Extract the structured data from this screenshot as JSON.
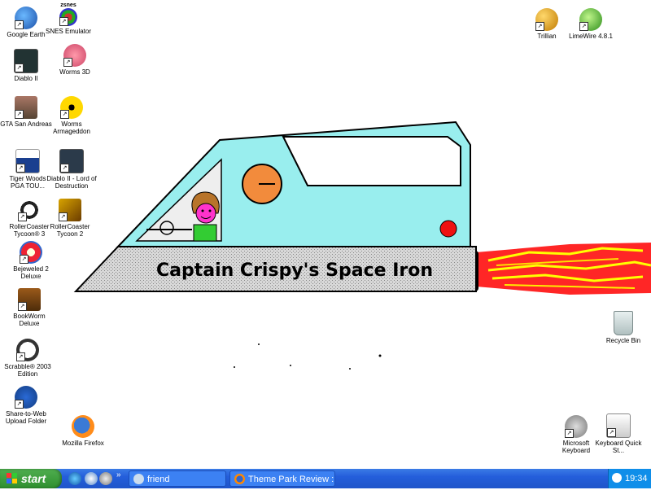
{
  "desktop_icons": {
    "google_earth": "Google Earth",
    "snes": "SNES Emulator",
    "snes_small": "zsnes",
    "trillian": "Trillian",
    "limewire": "LimeWire 4.8.1",
    "diablo2": "Diablo II",
    "worms3d": "Worms 3D",
    "gta": "GTA San Andreas",
    "worms_arm": "Worms Armageddon",
    "tiger": "Tiger Woods PGA TOU...",
    "diablo_lod": "Diablo II - Lord of Destruction",
    "rct3": "RollerCoaster Tycoon® 3",
    "rct2": "RollerCoaster Tycoon 2",
    "bejeweled": "Bejeweled 2 Deluxe",
    "bookworm": "BookWorm Deluxe",
    "scrabble": "Scrabble® 2003 Edition",
    "share_web": "Share-to-Web Upload Folder",
    "firefox": "Mozilla Firefox",
    "recycle": "Recycle Bin",
    "ms_keyboard": "Microsoft Keyboard",
    "keyboard_quick": "Keyboard Quick St..."
  },
  "wallpaper": {
    "title": "Captain Crispy's Space Iron"
  },
  "taskbar": {
    "start_label": "start",
    "chevron": "»",
    "tasks": [
      {
        "label": "friend"
      },
      {
        "label": "Theme Park Review :..."
      }
    ],
    "clock": "19:34"
  },
  "colors": {
    "taskbar": "#245edb",
    "start": "#3c9b3c",
    "cabin": "#99eeee",
    "body": "#cccccc",
    "flame_red": "#ff0000",
    "flame_yellow": "#ffff00"
  }
}
